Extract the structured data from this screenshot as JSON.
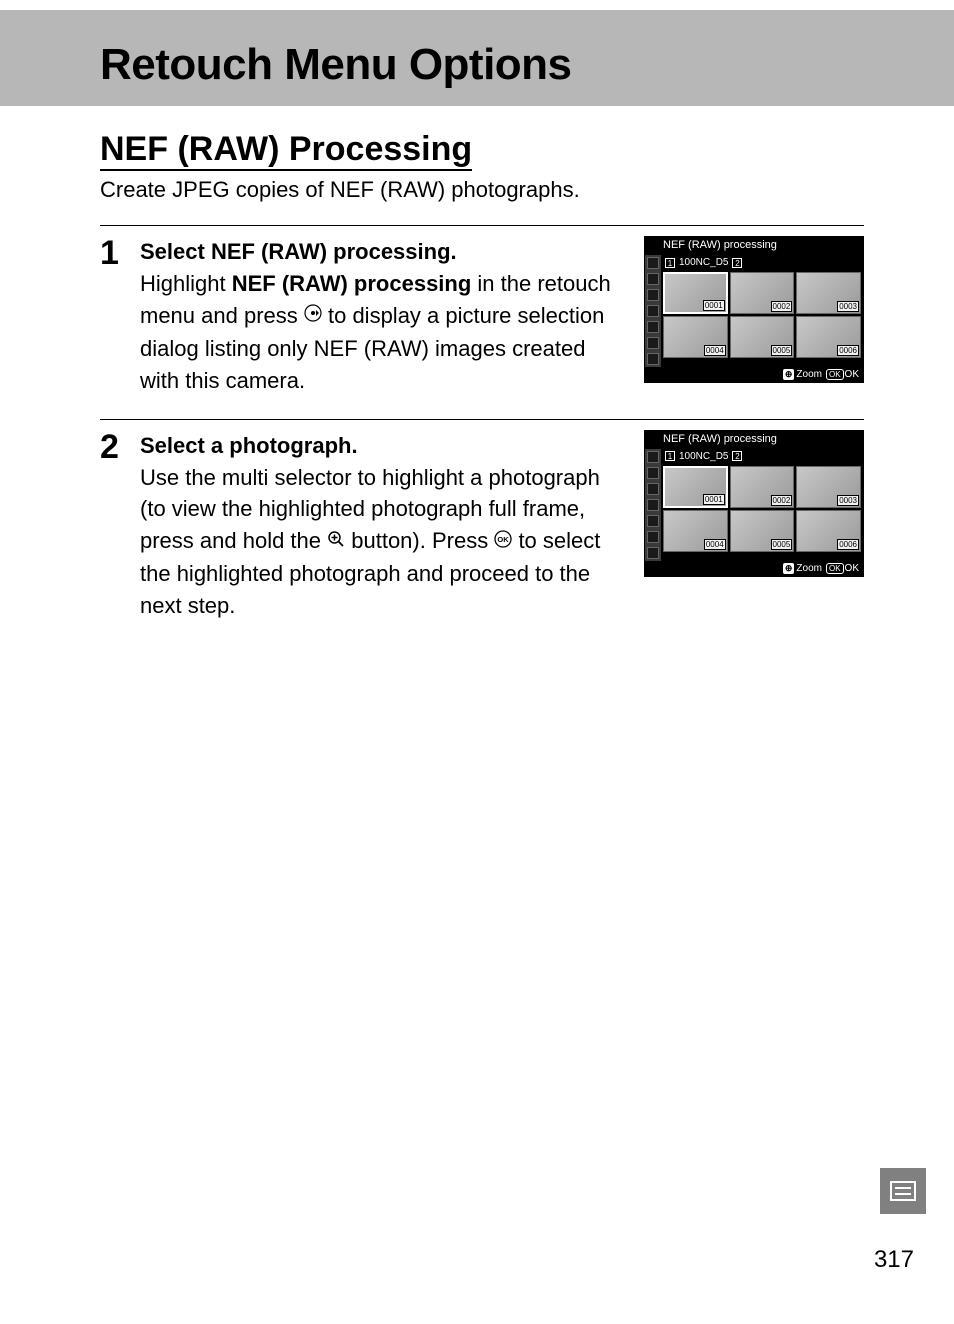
{
  "title": "Retouch Menu Options",
  "section": {
    "heading": "NEF (RAW) Processing",
    "intro": "Create JPEG copies of NEF (RAW) photographs."
  },
  "steps": [
    {
      "num": "1",
      "head_prefix": "Select ",
      "head_bold": "NEF (RAW) processing.",
      "body_prefix": "Highlight ",
      "body_bold": "NEF (RAW) processing",
      "body_mid": " in the retouch menu and press ",
      "body_suffix": " to display a picture selection dialog listing only NEF (RAW) images created with this camera."
    },
    {
      "num": "2",
      "head": "Select a photograph.",
      "body_a": "Use the multi selector to highlight a photograph (to view the highlighted photograph full frame, press and hold the ",
      "body_b": " button).  Press ",
      "body_c": " to select the highlighted photograph and proceed to the next step."
    }
  ],
  "lcd": {
    "title": "NEF (RAW) processing",
    "folder": "100NC_D5",
    "card1": "1",
    "card2": "2",
    "thumbs": [
      "0001",
      "0002",
      "0003",
      "0004",
      "0005",
      "0006"
    ],
    "zoom_label": "Zoom",
    "ok_pill": "OK",
    "ok_label": "OK",
    "zoom_icon": "⊕"
  },
  "page_number": "317"
}
